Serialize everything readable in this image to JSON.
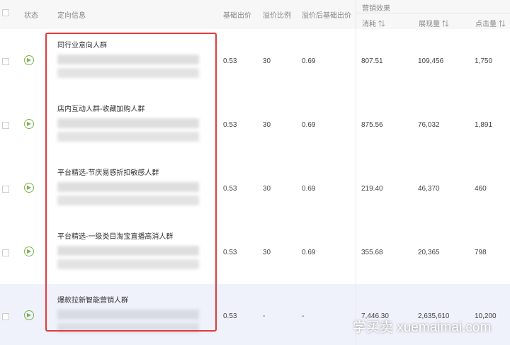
{
  "header": {
    "status": "状态",
    "targeting": "定向信息",
    "base_bid": "基础出价",
    "premium_ratio": "溢价比例",
    "premium_bid": "溢价后基础出价",
    "efficiency_group": "营销效果",
    "spend": "消耗 ⇅",
    "impressions": "展现量 ⇅",
    "clicks": "点击量 ⇅"
  },
  "rows": [
    {
      "name": "同行业意向人群",
      "base_bid": "0.53",
      "ratio": "30",
      "premium_bid": "0.69",
      "spend": "807.51",
      "impressions": "109,456",
      "clicks": "1,750"
    },
    {
      "name": "店内互动人群-收藏加购人群",
      "base_bid": "0.53",
      "ratio": "30",
      "premium_bid": "0.69",
      "spend": "875.56",
      "impressions": "76,032",
      "clicks": "1,891"
    },
    {
      "name": "平台精选-节庆易感折扣敏感人群",
      "base_bid": "0.53",
      "ratio": "30",
      "premium_bid": "0.69",
      "spend": "219.40",
      "impressions": "46,370",
      "clicks": "460"
    },
    {
      "name": "平台精选-一级类目淘宝直播高消人群",
      "base_bid": "0.53",
      "ratio": "30",
      "premium_bid": "0.69",
      "spend": "355.68",
      "impressions": "20,365",
      "clicks": "798"
    },
    {
      "name": "爆款拉新智能营销人群",
      "base_bid": "0.53",
      "ratio": "-",
      "premium_bid": "-",
      "spend": "7,446.30",
      "impressions": "2,635,610",
      "clicks": "10,200"
    }
  ],
  "watermark": "学买卖 xuemaimai.com",
  "icons": {
    "row_action": "play-circle-icon"
  },
  "colors": {
    "highlight_box": "#e23b3b",
    "play_icon": "#7cb24f",
    "selected_row": "#eff2fb"
  }
}
